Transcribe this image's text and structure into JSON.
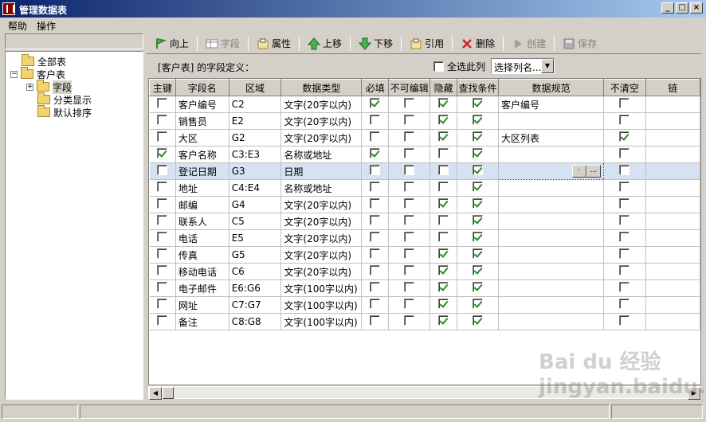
{
  "window": {
    "title": "管理数据表"
  },
  "menu": [
    "帮助",
    "操作"
  ],
  "tree": {
    "root": "全部表",
    "table": "客户表",
    "children": [
      "字段",
      "分类显示",
      "默认排序"
    ]
  },
  "toolbar": {
    "up": "向上",
    "field": "字段",
    "props": "属性",
    "moveup": "上移",
    "movedown": "下移",
    "ref": "引用",
    "delete": "删除",
    "create": "创建",
    "save": "保存"
  },
  "subheader": {
    "caption": "[客户表] 的字段定义：",
    "select_all": "全选此列",
    "combo": "选择列名..."
  },
  "columns": [
    "主键",
    "字段名",
    "区域",
    "数据类型",
    "必填",
    "不可编辑",
    "隐藏",
    "查找条件",
    "数据规范",
    "不清空",
    "链"
  ],
  "rows": [
    {
      "pk": false,
      "name": "客户编号",
      "range": "C2",
      "type": "文字(20字以内)",
      "required": true,
      "readonly": false,
      "hidden": true,
      "search": true,
      "spec": "客户编号",
      "keep": false
    },
    {
      "pk": false,
      "name": "销售员",
      "range": "E2",
      "type": "文字(20字以内)",
      "required": false,
      "readonly": false,
      "hidden": true,
      "search": true,
      "spec": "",
      "keep": false
    },
    {
      "pk": false,
      "name": "大区",
      "range": "G2",
      "type": "文字(20字以内)",
      "required": false,
      "readonly": false,
      "hidden": true,
      "search": true,
      "spec": "大区列表",
      "keep": true
    },
    {
      "pk": true,
      "name": "客户名称",
      "range": "C3:E3",
      "type": "名称或地址",
      "required": true,
      "readonly": false,
      "hidden": false,
      "search": true,
      "spec": "",
      "keep": false
    },
    {
      "pk": false,
      "name": "登记日期",
      "range": "G3",
      "type": "日期",
      "required": false,
      "readonly": false,
      "hidden": false,
      "search": true,
      "spec": "",
      "keep": false
    },
    {
      "pk": false,
      "name": "地址",
      "range": "C4:E4",
      "type": "名称或地址",
      "required": false,
      "readonly": false,
      "hidden": false,
      "search": true,
      "spec": "",
      "keep": false
    },
    {
      "pk": false,
      "name": "邮编",
      "range": "G4",
      "type": "文字(20字以内)",
      "required": false,
      "readonly": false,
      "hidden": true,
      "search": true,
      "spec": "",
      "keep": false
    },
    {
      "pk": false,
      "name": "联系人",
      "range": "C5",
      "type": "文字(20字以内)",
      "required": false,
      "readonly": false,
      "hidden": false,
      "search": true,
      "spec": "",
      "keep": false
    },
    {
      "pk": false,
      "name": "电话",
      "range": "E5",
      "type": "文字(20字以内)",
      "required": false,
      "readonly": false,
      "hidden": false,
      "search": true,
      "spec": "",
      "keep": false
    },
    {
      "pk": false,
      "name": "传真",
      "range": "G5",
      "type": "文字(20字以内)",
      "required": false,
      "readonly": false,
      "hidden": true,
      "search": true,
      "spec": "",
      "keep": false
    },
    {
      "pk": false,
      "name": "移动电话",
      "range": "C6",
      "type": "文字(20字以内)",
      "required": false,
      "readonly": false,
      "hidden": true,
      "search": true,
      "spec": "",
      "keep": false
    },
    {
      "pk": false,
      "name": "电子邮件",
      "range": "E6:G6",
      "type": "文字(100字以内)",
      "required": false,
      "readonly": false,
      "hidden": true,
      "search": true,
      "spec": "",
      "keep": false
    },
    {
      "pk": false,
      "name": "网址",
      "range": "C7:G7",
      "type": "文字(100字以内)",
      "required": false,
      "readonly": false,
      "hidden": true,
      "search": true,
      "spec": "",
      "keep": false
    },
    {
      "pk": false,
      "name": "备注",
      "range": "C8:G8",
      "type": "文字(100字以内)",
      "required": false,
      "readonly": false,
      "hidden": true,
      "search": true,
      "spec": "",
      "keep": false
    }
  ],
  "selected_row": 4,
  "cell_buttons": [
    "·",
    "..."
  ],
  "watermark": "Bai du 经验 jingyan.baidu.com"
}
